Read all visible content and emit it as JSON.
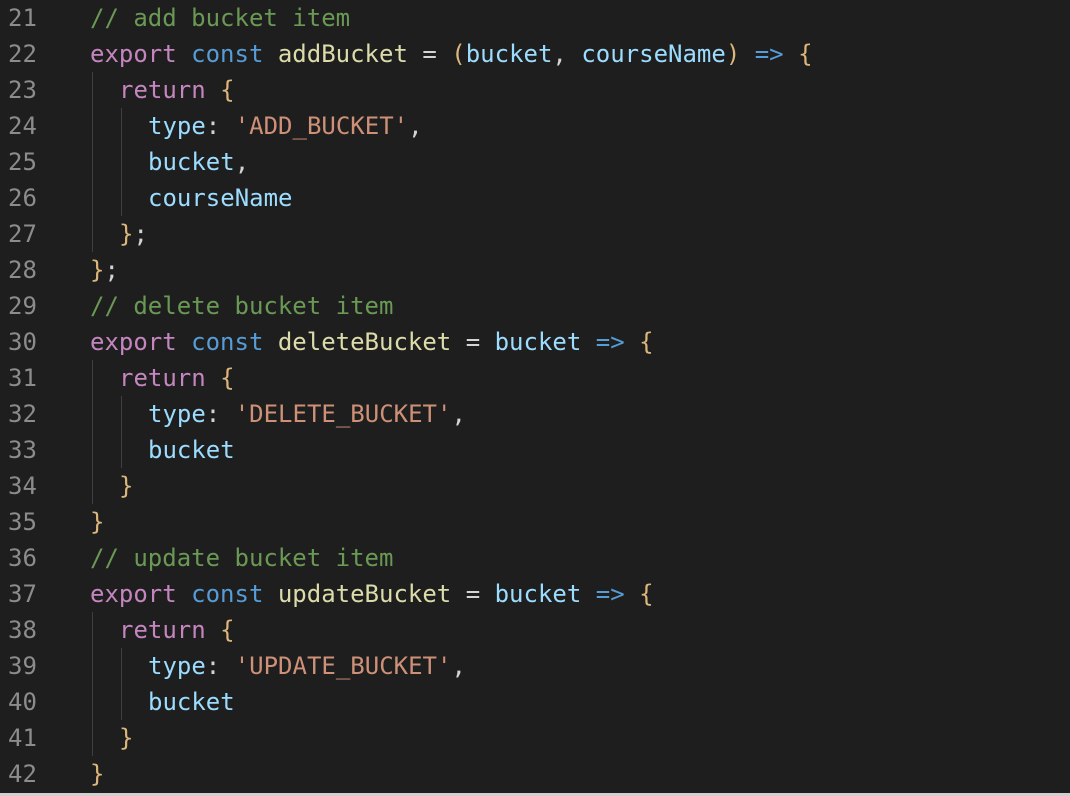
{
  "editor": {
    "lines": [
      {
        "num": "21",
        "indent": 0,
        "tokens": [
          {
            "t": "comment",
            "v": "// add bucket item"
          }
        ]
      },
      {
        "num": "22",
        "indent": 0,
        "tokens": [
          {
            "t": "keyword",
            "v": "export"
          },
          {
            "t": "plain",
            "v": " "
          },
          {
            "t": "storage",
            "v": "const"
          },
          {
            "t": "plain",
            "v": " "
          },
          {
            "t": "fn",
            "v": "addBucket"
          },
          {
            "t": "plain",
            "v": " = "
          },
          {
            "t": "brace",
            "v": "("
          },
          {
            "t": "param",
            "v": "bucket"
          },
          {
            "t": "plain",
            "v": ", "
          },
          {
            "t": "param",
            "v": "courseName"
          },
          {
            "t": "brace",
            "v": ")"
          },
          {
            "t": "plain",
            "v": " "
          },
          {
            "t": "arrow",
            "v": "=>"
          },
          {
            "t": "plain",
            "v": " "
          },
          {
            "t": "brace",
            "v": "{"
          }
        ]
      },
      {
        "num": "23",
        "indent": 1,
        "tokens": [
          {
            "t": "keyword",
            "v": "return"
          },
          {
            "t": "plain",
            "v": " "
          },
          {
            "t": "brace",
            "v": "{"
          }
        ]
      },
      {
        "num": "24",
        "indent": 2,
        "tokens": [
          {
            "t": "var",
            "v": "type"
          },
          {
            "t": "plain",
            "v": ": "
          },
          {
            "t": "str",
            "v": "'ADD_BUCKET'"
          },
          {
            "t": "plain",
            "v": ","
          }
        ]
      },
      {
        "num": "25",
        "indent": 2,
        "tokens": [
          {
            "t": "var",
            "v": "bucket"
          },
          {
            "t": "plain",
            "v": ","
          }
        ]
      },
      {
        "num": "26",
        "indent": 2,
        "tokens": [
          {
            "t": "var",
            "v": "courseName"
          }
        ]
      },
      {
        "num": "27",
        "indent": 1,
        "tokens": [
          {
            "t": "brace",
            "v": "}"
          },
          {
            "t": "plain",
            "v": ";"
          }
        ]
      },
      {
        "num": "28",
        "indent": 0,
        "tokens": [
          {
            "t": "brace",
            "v": "}"
          },
          {
            "t": "plain",
            "v": ";"
          }
        ]
      },
      {
        "num": "29",
        "indent": 0,
        "tokens": [
          {
            "t": "comment",
            "v": "// delete bucket item"
          }
        ]
      },
      {
        "num": "30",
        "indent": 0,
        "tokens": [
          {
            "t": "keyword",
            "v": "export"
          },
          {
            "t": "plain",
            "v": " "
          },
          {
            "t": "storage",
            "v": "const"
          },
          {
            "t": "plain",
            "v": " "
          },
          {
            "t": "fn",
            "v": "deleteBucket"
          },
          {
            "t": "plain",
            "v": " = "
          },
          {
            "t": "param",
            "v": "bucket"
          },
          {
            "t": "plain",
            "v": " "
          },
          {
            "t": "arrow",
            "v": "=>"
          },
          {
            "t": "plain",
            "v": " "
          },
          {
            "t": "brace",
            "v": "{"
          }
        ]
      },
      {
        "num": "31",
        "indent": 1,
        "tokens": [
          {
            "t": "keyword",
            "v": "return"
          },
          {
            "t": "plain",
            "v": " "
          },
          {
            "t": "brace",
            "v": "{"
          }
        ]
      },
      {
        "num": "32",
        "indent": 2,
        "tokens": [
          {
            "t": "var",
            "v": "type"
          },
          {
            "t": "plain",
            "v": ": "
          },
          {
            "t": "str",
            "v": "'DELETE_BUCKET'"
          },
          {
            "t": "plain",
            "v": ","
          }
        ]
      },
      {
        "num": "33",
        "indent": 2,
        "tokens": [
          {
            "t": "var",
            "v": "bucket"
          }
        ]
      },
      {
        "num": "34",
        "indent": 1,
        "tokens": [
          {
            "t": "brace",
            "v": "}"
          }
        ]
      },
      {
        "num": "35",
        "indent": 0,
        "tokens": [
          {
            "t": "brace",
            "v": "}"
          }
        ]
      },
      {
        "num": "36",
        "indent": 0,
        "tokens": [
          {
            "t": "comment",
            "v": "// update bucket item"
          }
        ]
      },
      {
        "num": "37",
        "indent": 0,
        "tokens": [
          {
            "t": "keyword",
            "v": "export"
          },
          {
            "t": "plain",
            "v": " "
          },
          {
            "t": "storage",
            "v": "const"
          },
          {
            "t": "plain",
            "v": " "
          },
          {
            "t": "fn",
            "v": "updateBucket"
          },
          {
            "t": "plain",
            "v": " = "
          },
          {
            "t": "param",
            "v": "bucket"
          },
          {
            "t": "plain",
            "v": " "
          },
          {
            "t": "arrow",
            "v": "=>"
          },
          {
            "t": "plain",
            "v": " "
          },
          {
            "t": "brace",
            "v": "{"
          }
        ]
      },
      {
        "num": "38",
        "indent": 1,
        "tokens": [
          {
            "t": "keyword",
            "v": "return"
          },
          {
            "t": "plain",
            "v": " "
          },
          {
            "t": "brace",
            "v": "{"
          }
        ]
      },
      {
        "num": "39",
        "indent": 2,
        "tokens": [
          {
            "t": "var",
            "v": "type"
          },
          {
            "t": "plain",
            "v": ": "
          },
          {
            "t": "str",
            "v": "'UPDATE_BUCKET'"
          },
          {
            "t": "plain",
            "v": ","
          }
        ]
      },
      {
        "num": "40",
        "indent": 2,
        "tokens": [
          {
            "t": "var",
            "v": "bucket"
          }
        ]
      },
      {
        "num": "41",
        "indent": 1,
        "tokens": [
          {
            "t": "brace",
            "v": "}"
          }
        ]
      },
      {
        "num": "42",
        "indent": 0,
        "tokens": [
          {
            "t": "brace",
            "v": "}"
          }
        ]
      }
    ]
  },
  "colors": {
    "background": "#1e1e1e",
    "line_number": "#8c8c8c",
    "comment": "#6a9955",
    "keyword": "#c586c0",
    "storage": "#569cd6",
    "function": "#dcdcaa",
    "variable": "#9cdcfe",
    "string": "#ce9178",
    "brace": "#dcb67a"
  }
}
